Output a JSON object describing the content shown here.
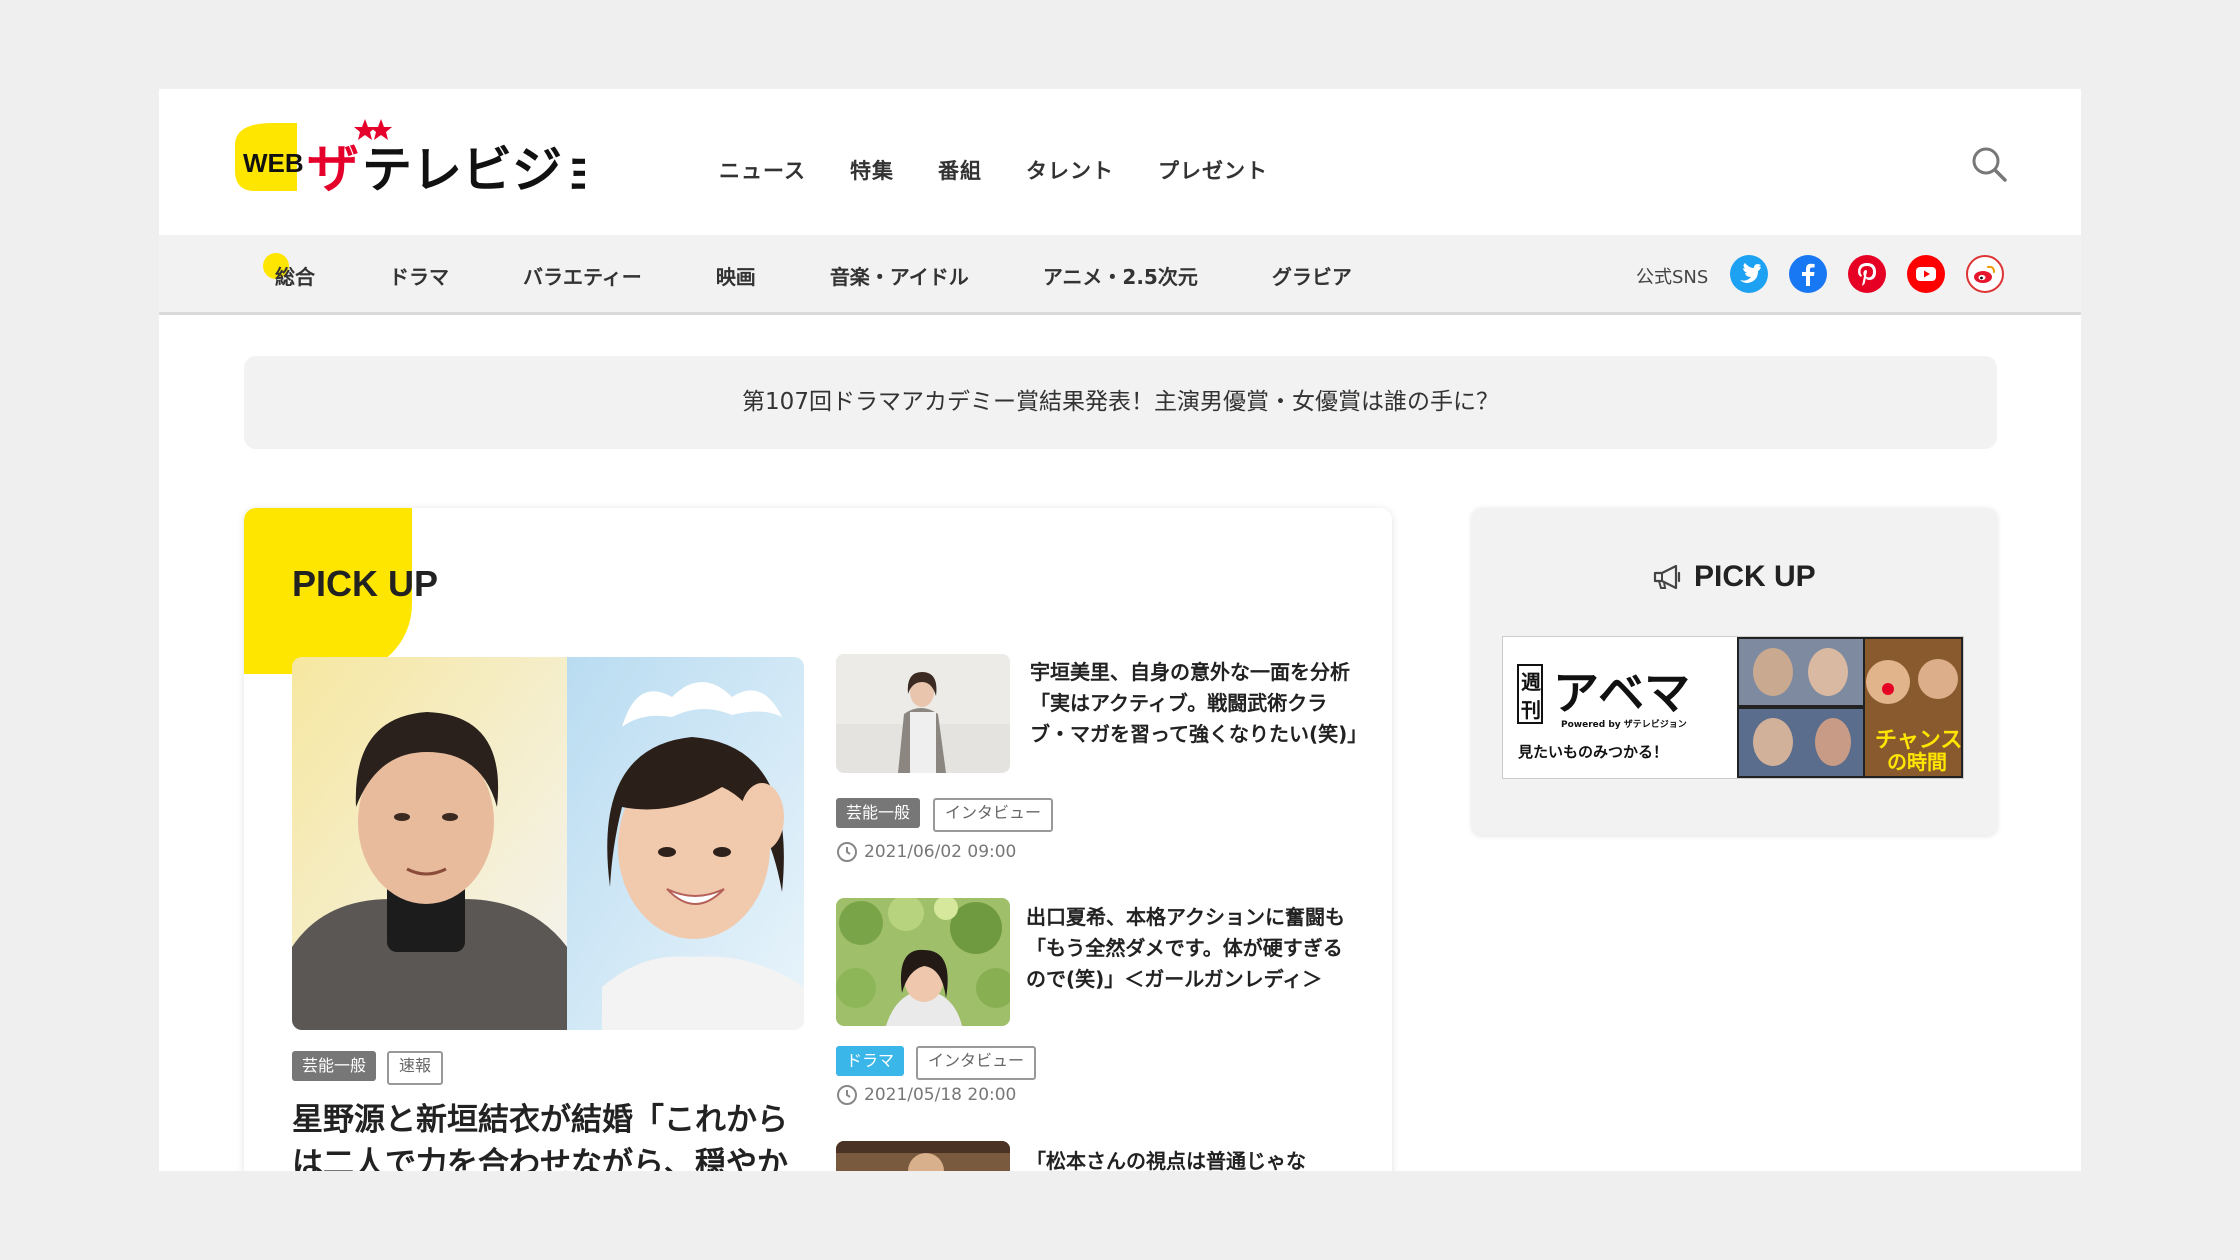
{
  "brand": {
    "web": "WEB",
    "name": "ザテレビジョン"
  },
  "top_nav": [
    "ニュース",
    "特集",
    "番組",
    "タレント",
    "プレゼント"
  ],
  "categories": [
    "総合",
    "ドラマ",
    "バラエティー",
    "映画",
    "音楽・アイドル",
    "アニメ・2.5次元",
    "グラビア"
  ],
  "active_category": "総合",
  "sns": {
    "label": "公式SNS",
    "icons": [
      "twitter-icon",
      "facebook-icon",
      "pinterest-icon",
      "youtube-icon",
      "weibo-icon"
    ]
  },
  "headline_banner": "第107回ドラマアカデミー賞結果発表！主演男優賞・女優賞は誰の手に？",
  "pickup": {
    "title": "PICK UP",
    "main": {
      "tags": [
        "芸能一般",
        "速報"
      ],
      "headline": "星野源と新垣結衣が結婚「これからは二人で力を合わせながら、穏やかに生"
    },
    "articles": [
      {
        "title": "宇垣美里、自身の意外な一面を分析「実はアクティブ。戦闘武術クラブ・マガを習って強くなりたい(笑)」",
        "tags": [
          "芸能一般",
          "インタビュー"
        ],
        "date": "2021/06/02 09:00"
      },
      {
        "title": "出口夏希、本格アクションに奮闘も「もう全然ダメです。体が硬すぎるので(笑)」＜ガールガンレディ＞",
        "tags": [
          "ドラマ",
          "インタビュー"
        ],
        "date": "2021/05/18 20:00"
      },
      {
        "title": "「松本さんの視点は普通じゃな"
      }
    ]
  },
  "side_pickup": {
    "title": "PICK UP",
    "ad": {
      "shuu": "週",
      "kan": "刊",
      "name": "アベマ",
      "powered": "Powered by ザテレビジョン",
      "tagline": "見たいものみつかる！"
    }
  },
  "colors": {
    "accent_yellow": "#ffe600",
    "drama_blue": "#3bb6e8",
    "twitter": "#1da1f2",
    "facebook": "#1877f2",
    "pinterest": "#e60023",
    "youtube": "#ff0000"
  }
}
